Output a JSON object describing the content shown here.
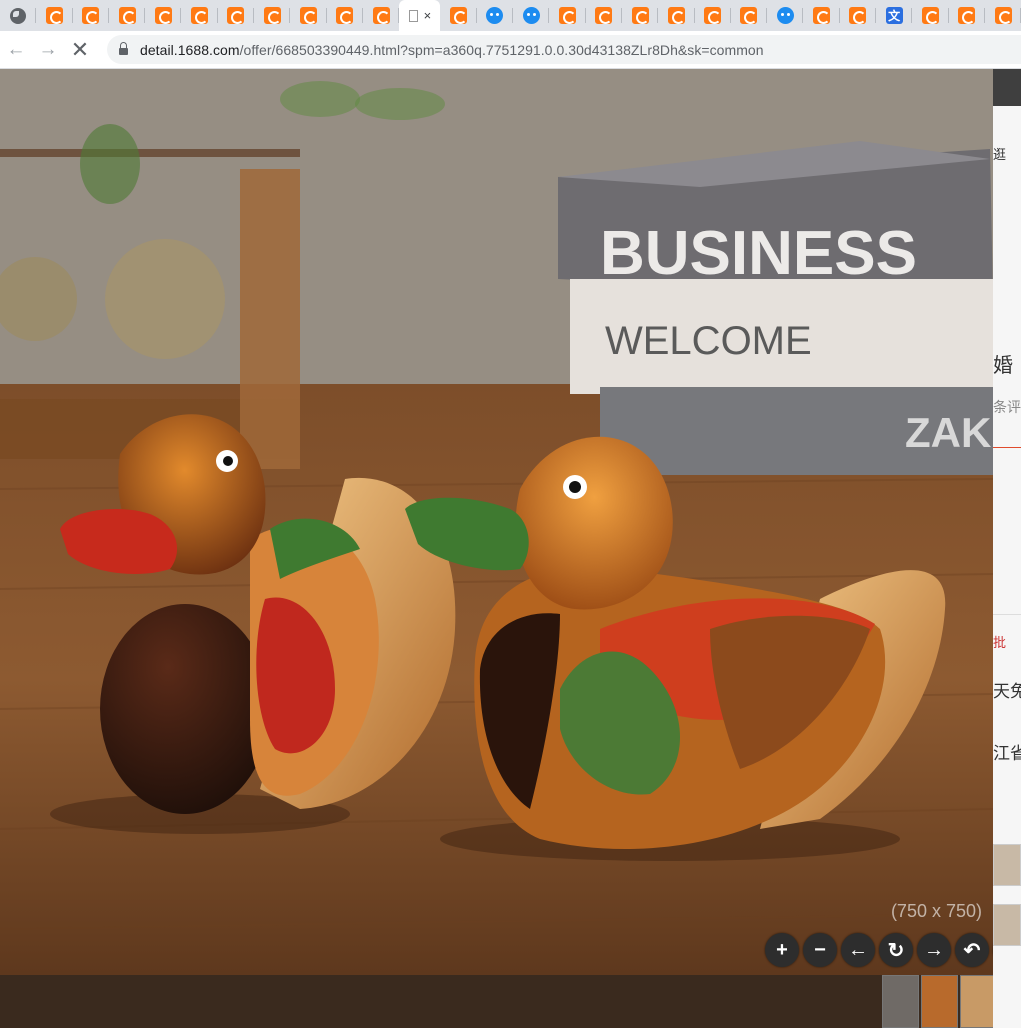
{
  "browser": {
    "tabs": [
      {
        "icon": "globe-icon"
      },
      {
        "icon": "1688-icon"
      },
      {
        "icon": "1688-icon"
      },
      {
        "icon": "1688-icon"
      },
      {
        "icon": "1688-icon"
      },
      {
        "icon": "1688-icon"
      },
      {
        "icon": "1688-icon"
      },
      {
        "icon": "1688-icon"
      },
      {
        "icon": "1688-icon"
      },
      {
        "icon": "1688-icon"
      },
      {
        "icon": "1688-icon"
      },
      {
        "icon": "active",
        "close": "×"
      },
      {
        "icon": "1688-icon"
      },
      {
        "icon": "blue-bird-icon"
      },
      {
        "icon": "blue-bird-icon"
      },
      {
        "icon": "1688-icon"
      },
      {
        "icon": "1688-icon"
      },
      {
        "icon": "1688-icon"
      },
      {
        "icon": "1688-icon"
      },
      {
        "icon": "1688-icon"
      },
      {
        "icon": "1688-icon"
      },
      {
        "icon": "blue-bird-icon"
      },
      {
        "icon": "1688-icon"
      },
      {
        "icon": "1688-icon"
      },
      {
        "icon": "translate-icon"
      },
      {
        "icon": "1688-icon"
      },
      {
        "icon": "1688-icon"
      },
      {
        "icon": "1688-icon"
      }
    ],
    "url_host": "detail.1688.com",
    "url_path": "/offer/668503390449.html?spm=a360q.7751291.0.0.30d43138ZLr8Dh&sk=common",
    "back_glyph": "←",
    "forward_glyph": "→",
    "stop_glyph": "✕"
  },
  "viewer": {
    "image_size_label": "(750 x 750)",
    "controls": [
      {
        "name": "zoom-in-button",
        "glyph": "+"
      },
      {
        "name": "zoom-out-button",
        "glyph": "−"
      },
      {
        "name": "previous-button",
        "glyph": "←"
      },
      {
        "name": "rotate-button",
        "glyph": "↻"
      },
      {
        "name": "next-button",
        "glyph": "→"
      },
      {
        "name": "undo-button",
        "glyph": "↶"
      },
      {
        "name": "redo-button",
        "glyph": "↷"
      }
    ],
    "photo_text": {
      "book_top": "BUSINESS",
      "book_middle": "WELCOME",
      "book_bottom": "ZAK"
    }
  },
  "side_page": {
    "snippets": [
      "逛",
      "婚",
      "条评",
      "批",
      "天免",
      "江省"
    ]
  },
  "colors": {
    "tab_bg": "#dee1e6",
    "accent_1688": "#ff7a14",
    "viewer_btn": "#2d2d2d"
  }
}
